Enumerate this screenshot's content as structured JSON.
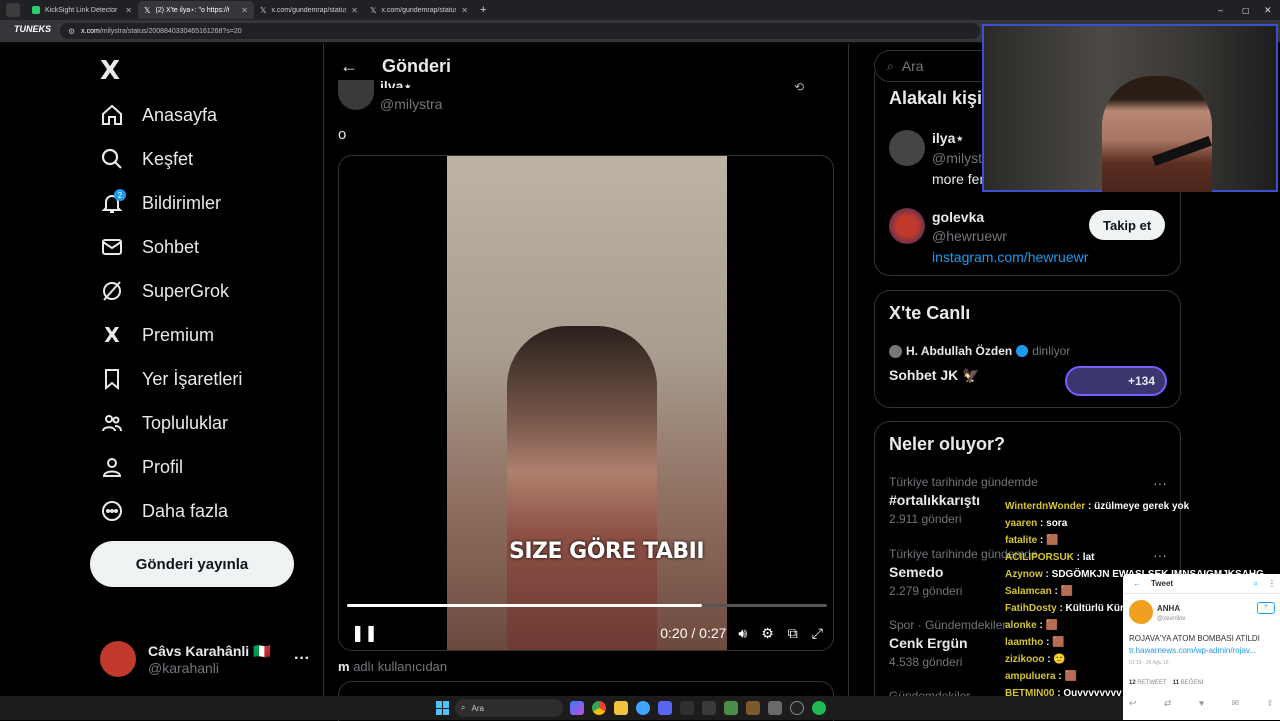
{
  "browser": {
    "tabs": [
      {
        "label": "KickSight Link Detector",
        "active": false
      },
      {
        "label": "(2) X'te ilya⋆: \"o https://t.c",
        "active": true
      },
      {
        "label": "x.com/gundemrap/status/200",
        "active": false
      },
      {
        "label": "x.com/gundemrap/status/200",
        "active": false
      }
    ],
    "url_host": "x.com",
    "url_path": "/milystra/status/2008840330465161268?s=20",
    "brand_overlay": "TUNEKS"
  },
  "nav": {
    "logo": "X",
    "items": [
      {
        "label": "Anasayfa",
        "icon": "home-icon"
      },
      {
        "label": "Keşfet",
        "icon": "search-icon"
      },
      {
        "label": "Bildirimler",
        "icon": "bell-icon",
        "badge": "2"
      },
      {
        "label": "Sohbet",
        "icon": "mail-icon"
      },
      {
        "label": "SuperGrok",
        "icon": "grok-icon"
      },
      {
        "label": "Premium",
        "icon": "x-logo-icon"
      },
      {
        "label": "Yer İşaretleri",
        "icon": "bookmark-icon"
      },
      {
        "label": "Topluluklar",
        "icon": "communities-icon"
      },
      {
        "label": "Profil",
        "icon": "profile-icon"
      },
      {
        "label": "Daha fazla",
        "icon": "more-circle-icon"
      }
    ],
    "post_button": "Gönderi yayınla",
    "account": {
      "name": "Câvs Karahânli 🇮🇹",
      "handle": "@karahanli"
    }
  },
  "post": {
    "header_title": "Gönderi",
    "author_name": "ilya⋆",
    "author_handle": "@milystra",
    "text": "o",
    "video": {
      "caption": "SIZE GÖRE TABII",
      "time": "0:20 / 0:27",
      "progress": 0.74
    },
    "reply_hint_user": "m",
    "reply_hint_text": "adlı kullanıcıdan"
  },
  "right": {
    "search_placeholder": "Ara",
    "related": {
      "title": "Alakalı kişi",
      "people": [
        {
          "name": "ilya⋆",
          "handle": "@milystr",
          "bio": "more fem"
        },
        {
          "name": "golevka",
          "handle": "@hewruewr",
          "bio": "instagram.com/hewruewr",
          "follow": "Takip et"
        }
      ]
    },
    "live": {
      "title": "X'te Canlı",
      "host": "H. Abdullah Özden",
      "status": "dinliyor",
      "space": "Sohbet JK 🦅",
      "count": "+134"
    },
    "trends": {
      "title": "Neler oluyor?",
      "items": [
        {
          "context": "Türkiye tarihinde gündemde",
          "name": "#ortalıkkarıştı",
          "count": "2.911 gönderi"
        },
        {
          "context": "Türkiye tarihinde gündemde",
          "name": "Semedo",
          "count": "2.279 gönderi"
        },
        {
          "context": "Spor · Gündemdekiler",
          "name": "Cenk Ergün",
          "count": "4.538 gönderi"
        },
        {
          "context": "Gündemdekiler",
          "name": "",
          "count": ""
        }
      ]
    }
  },
  "chat": [
    {
      "user": "WinterdnWonder",
      "msg": "üzülmeye gerek yok"
    },
    {
      "user": "yaaren",
      "msg": "sora"
    },
    {
      "user": "fatalite",
      "msg": "🟫"
    },
    {
      "user": "ACILIPORSUK",
      "msg": "lat"
    },
    {
      "user": "Azynow",
      "msg": "SDGÖMKJN EWASLŞEK IMNSAIGMJKSAHG"
    },
    {
      "user": "Salamcan",
      "msg": "🟫"
    },
    {
      "user": "FatihDosty",
      "msg": "Kültürlü Kürt"
    },
    {
      "user": "alonke",
      "msg": "🟫"
    },
    {
      "user": "laamtho",
      "msg": "🟫"
    },
    {
      "user": "zizikooo",
      "msg": "🙂"
    },
    {
      "user": "ampuluera",
      "msg": "🟫"
    },
    {
      "user": "BETMIN00",
      "msg": "Ouvvvvvvvv"
    }
  ],
  "popup": {
    "title": "Tweet",
    "account": "ANHA",
    "handle": "@zevrrilov",
    "text": "ROJAVA'YA ATOM BOMBASI ATILDI",
    "link": "tr.hawarnews.com/wp-admin/rojav...",
    "meta": "01:19 · 26 Ağu 16",
    "retweets": "12",
    "retweets_label": "RETWEET",
    "likes": "11",
    "likes_label": "BEĞENİ"
  },
  "taskbar": {
    "search": "Ara"
  },
  "colors": {
    "accent": "#1d9bf0",
    "background": "#000000",
    "border": "#2f3336",
    "chat_user": "#d6c531",
    "webcam_border": "#3b4fd0"
  }
}
